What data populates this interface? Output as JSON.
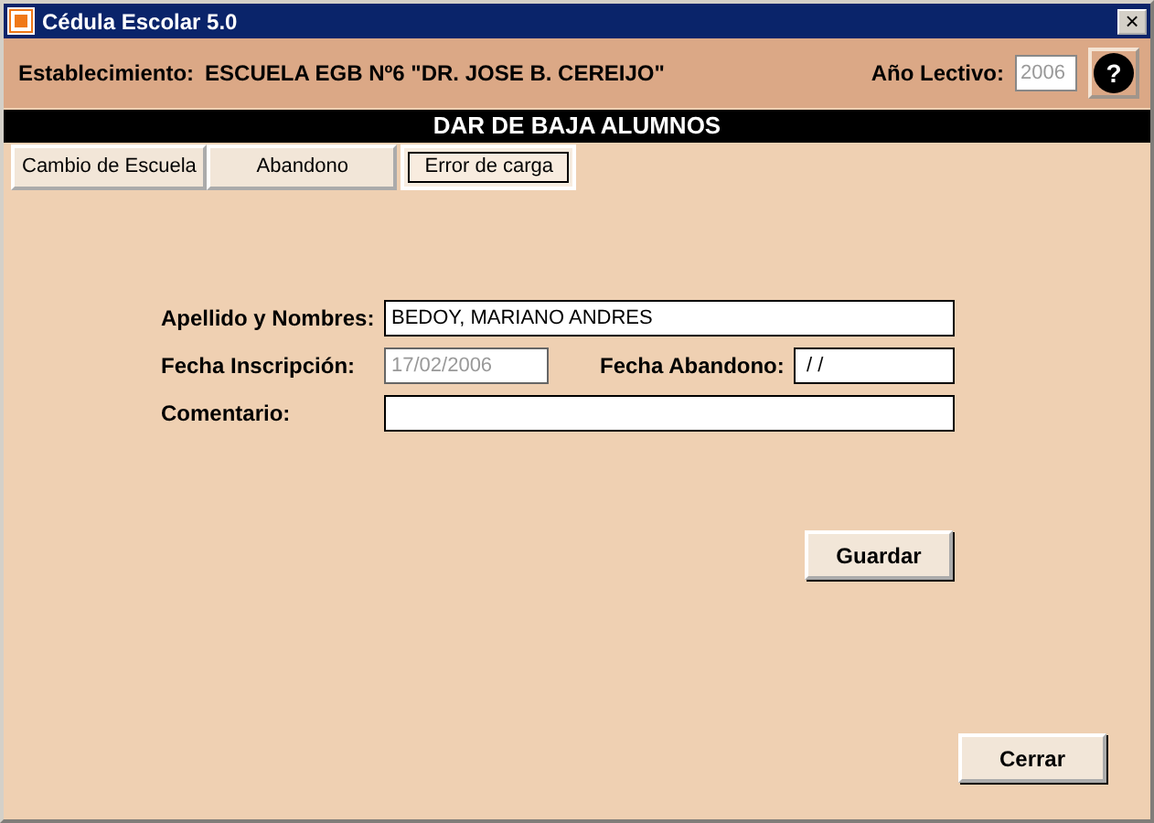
{
  "window": {
    "title": "Cédula Escolar 5.0",
    "close": "×"
  },
  "header": {
    "school_label": "Establecimiento:",
    "school": "ESCUELA EGB Nº6 \"DR. JOSE B. CEREIJO\"",
    "year_label": "Año Lectivo:",
    "year": "2006",
    "help": "?"
  },
  "banner": "DAR DE BAJA ALUMNOS",
  "tabs": [
    {
      "label": "Cambio de Escuela",
      "selected": false
    },
    {
      "label": "Abandono",
      "selected": false
    },
    {
      "label": "Error de carga",
      "selected": true
    }
  ],
  "form": {
    "name_label": "Apellido y Nombres:",
    "name": "BEDOY, MARIANO ANDRES",
    "inscription_label": "Fecha Inscripción:",
    "inscription": "17/02/2006",
    "inscription_disabled": true,
    "abandon_label": "Fecha Abandono:",
    "abandon": " / /",
    "comment_label": "Comentario:"
  },
  "buttons": {
    "save": "Guardar",
    "close": "Cerrar"
  }
}
